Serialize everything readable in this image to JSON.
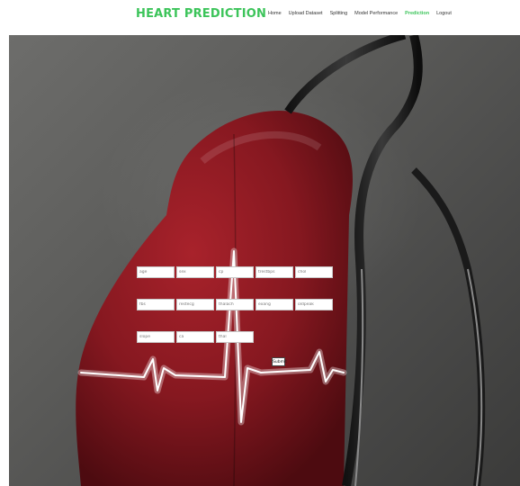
{
  "brand": {
    "title": "HEART PREDICTION",
    "color": "#3cc45a"
  },
  "nav": {
    "items": [
      {
        "label": "Home"
      },
      {
        "label": "Upload Dataset"
      },
      {
        "label": "Splitting"
      },
      {
        "label": "Model Performance"
      },
      {
        "label": "Prediction",
        "active": true,
        "color": "#3cc45a"
      },
      {
        "label": "Logout"
      }
    ]
  },
  "form": {
    "fields": [
      {
        "placeholder": "age"
      },
      {
        "placeholder": "sex"
      },
      {
        "placeholder": "cp"
      },
      {
        "placeholder": "trestbps"
      },
      {
        "placeholder": "chol"
      },
      {
        "placeholder": "fbs"
      },
      {
        "placeholder": "restecg"
      },
      {
        "placeholder": "thalach"
      },
      {
        "placeholder": "exang"
      },
      {
        "placeholder": "oldpeak"
      },
      {
        "placeholder": "slope"
      },
      {
        "placeholder": "ca"
      },
      {
        "placeholder": "thal"
      }
    ],
    "submit_label": "Submit"
  },
  "colors": {
    "heart": "#8e1b22",
    "background": "#5e5e5c"
  }
}
